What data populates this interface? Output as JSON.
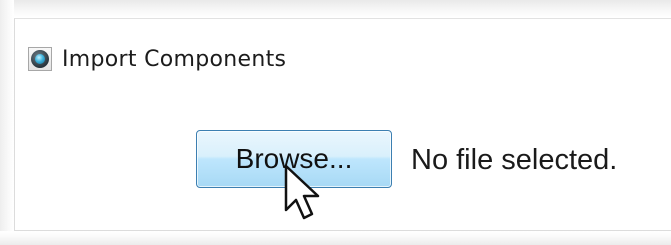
{
  "import_option": {
    "label": "Import Components",
    "selected": true,
    "icon": "radio-selected-icon"
  },
  "browse": {
    "button_label": "Browse...",
    "status_text": "No file selected."
  },
  "cursor": {
    "icon": "arrow-cursor-icon"
  },
  "colors": {
    "button_border": "#3c7fb1",
    "button_top": "#eaf6fd",
    "button_bottom": "#a7d9f5",
    "radio_dot": "#3fb3dc"
  }
}
